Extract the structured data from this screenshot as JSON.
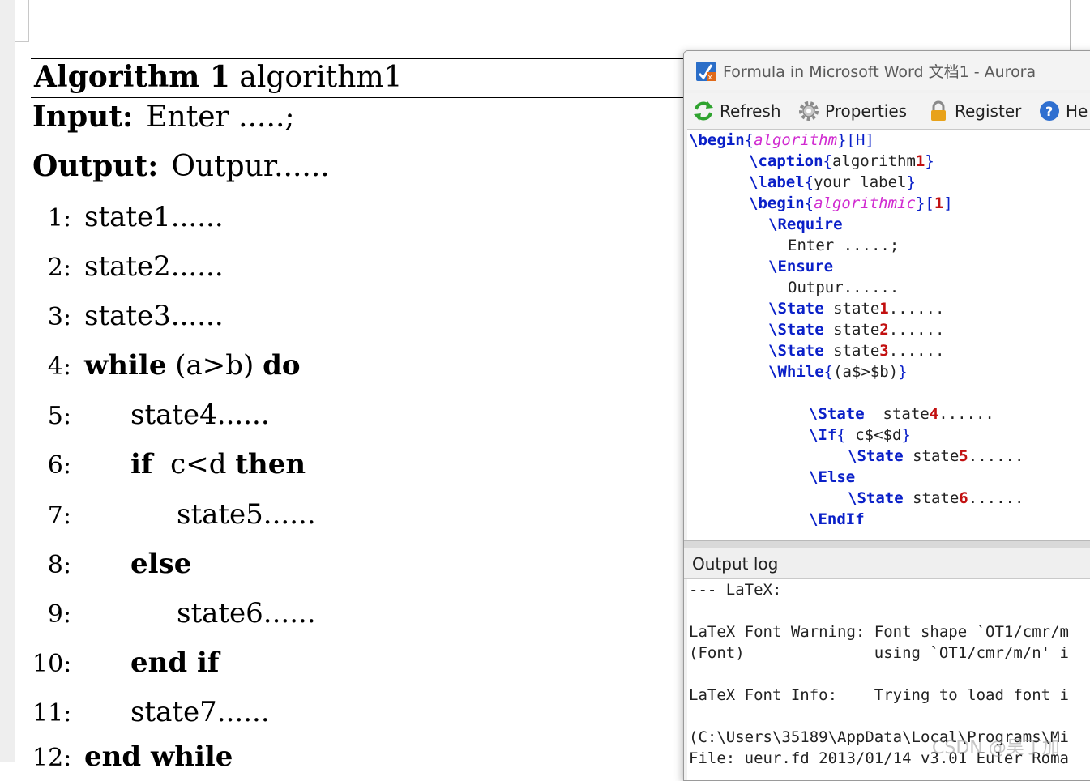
{
  "document": {
    "caption_bold": "Algorithm 1",
    "caption_text": "algorithm1",
    "input_label": "Input:",
    "input_text": "Enter .....;",
    "output_label": "Output:",
    "output_text": "Outpur......",
    "lines": [
      {
        "num": "1:",
        "text": "state1......"
      },
      {
        "num": "2:",
        "text": "state2......"
      },
      {
        "num": "3:",
        "text": "state3......"
      },
      {
        "num": "4:",
        "kw1": "while",
        "text": "(a>b)",
        "kw2": "do"
      },
      {
        "num": "5:",
        "text": "state4......"
      },
      {
        "num": "6:",
        "kw1": "if",
        "text": "c<d",
        "kw2": "then"
      },
      {
        "num": "7:",
        "text": "state5......"
      },
      {
        "num": "8:",
        "kw1": "else"
      },
      {
        "num": "9:",
        "text": "state6......"
      },
      {
        "num": "10:",
        "kw1": "end if"
      },
      {
        "num": "11:",
        "text": "state7......"
      },
      {
        "num": "12:",
        "kw1": "end while"
      }
    ]
  },
  "aurora": {
    "title": "Formula in Microsoft Word 文档1 - Aurora",
    "toolbar": {
      "refresh": "Refresh",
      "properties": "Properties",
      "register": "Register",
      "help": "He"
    },
    "code": {
      "l1_cmd": "\\begin",
      "l1_env": "algorithm",
      "l1_opt": "[H]",
      "l2_cmd": "\\caption",
      "l2_a": "algorithm",
      "l2_b": "1",
      "l3_cmd": "\\label",
      "l3_text": "your label",
      "l4_cmd": "\\begin",
      "l4_env": "algorithmic",
      "l4_opt": "1",
      "l5_cmd": "\\Require",
      "l6_text": "Enter .....;",
      "l7_cmd": "\\Ensure",
      "l8_text": "Outpur......",
      "l9_cmd": "\\State",
      "l9_a": "state",
      "l9_b": "1",
      "l9_c": "......",
      "l10_cmd": "\\State",
      "l10_a": "state",
      "l10_b": "2",
      "l10_c": "......",
      "l11_cmd": "\\State",
      "l11_a": "state",
      "l11_b": "3",
      "l11_c": "......",
      "l12_cmd": "\\While",
      "l12_text": "(a$>$b)",
      "l13_cmd": "\\State",
      "l13_a": "state",
      "l13_b": "4",
      "l13_c": "......",
      "l14_cmd": "\\If",
      "l14_text": "c$<$d",
      "l15_cmd": "\\State",
      "l15_a": "state",
      "l15_b": "5",
      "l15_c": "......",
      "l16_cmd": "\\Else",
      "l17_cmd": "\\State",
      "l17_a": "state",
      "l17_b": "6",
      "l17_c": "......",
      "l18_cmd": "\\EndIf"
    },
    "log_header": "Output log",
    "log": [
      "--- LaTeX:",
      "",
      "LaTeX Font Warning: Font shape `OT1/cmr/m",
      "(Font)              using `OT1/cmr/m/n' i",
      "",
      "LaTeX Font Info:    Trying to load font i",
      "",
      "(C:\\Users\\35189\\AppData\\Local\\Programs\\Mi",
      "File: ueur.fd 2013/01/14 v3.01 Euler Roma"
    ]
  },
  "watermark": "CSDN @吴丁加"
}
